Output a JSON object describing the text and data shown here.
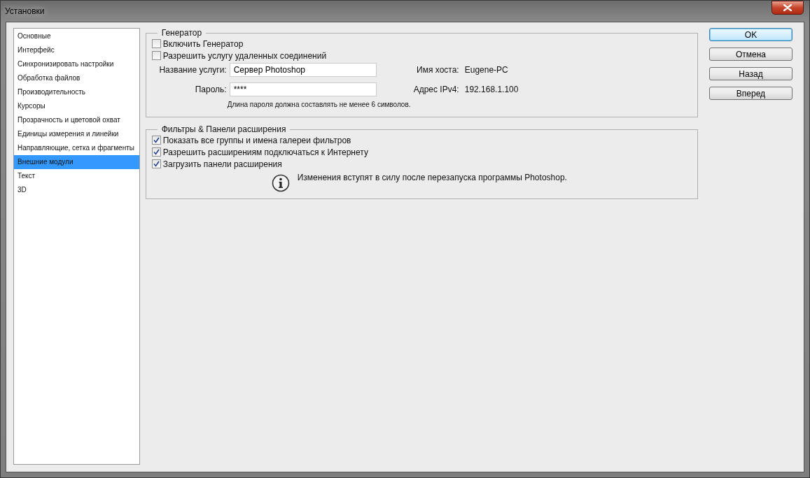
{
  "window": {
    "title": "Установки"
  },
  "sidebar": {
    "items": [
      {
        "label": "Основные",
        "selected": false
      },
      {
        "label": "Интерфейс",
        "selected": false
      },
      {
        "label": "Синхронизировать настройки",
        "selected": false
      },
      {
        "label": "Обработка файлов",
        "selected": false
      },
      {
        "label": "Производительность",
        "selected": false
      },
      {
        "label": "Курсоры",
        "selected": false
      },
      {
        "label": "Прозрачность и цветовой охват",
        "selected": false
      },
      {
        "label": "Единицы измерения и линейки",
        "selected": false
      },
      {
        "label": "Направляющие, сетка и фрагменты",
        "selected": false
      },
      {
        "label": "Внешние модули",
        "selected": true
      },
      {
        "label": "Текст",
        "selected": false
      },
      {
        "label": "3D",
        "selected": false
      }
    ]
  },
  "generator": {
    "title": "Генератор",
    "checkboxes": [
      {
        "label": "Включить Генератор",
        "checked": false
      },
      {
        "label": "Разрешить услугу удаленных соединений",
        "checked": false
      }
    ],
    "fields": [
      {
        "label": "Название услуги:",
        "value": "Сервер Photoshop",
        "info_label": "Имя хоста:",
        "info_value": "Eugene-PC"
      },
      {
        "label": "Пароль:",
        "value": "****",
        "info_label": "Адрес IPv4:",
        "info_value": "192.168.1.100"
      }
    ],
    "hint": "Длина пароля должна составлять не менее 6 символов."
  },
  "filters": {
    "title": "Фильтры & Панели расширения",
    "checkboxes": [
      {
        "label": "Показать все группы и имена галереи фильтров",
        "checked": true
      },
      {
        "label": "Разрешить расширениям подключаться к Интернету",
        "checked": true
      },
      {
        "label": "Загрузить панели расширения",
        "checked": true
      }
    ],
    "notice": "Изменения вступят в силу после перезапуска программы Photoshop."
  },
  "buttons": [
    {
      "label": "OK",
      "default": true
    },
    {
      "label": "Отмена",
      "default": false
    },
    {
      "label": "Назад",
      "default": false
    },
    {
      "label": "Вперед",
      "default": false
    }
  ]
}
